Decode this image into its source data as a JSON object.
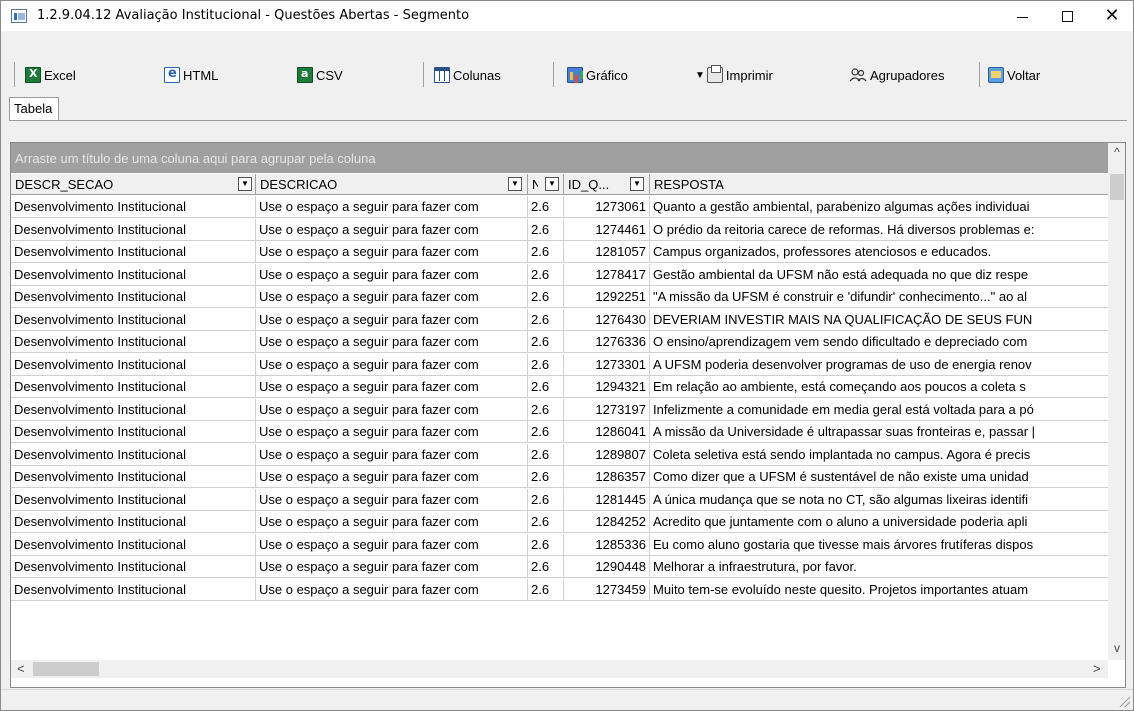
{
  "window": {
    "title": "1.2.9.04.12 Avaliação Institucional - Questões Abertas - Segmento",
    "minimize_glyph": "—",
    "maximize_glyph": "☐",
    "close_glyph": "✕"
  },
  "toolbar": {
    "excel": "Excel",
    "html": "HTML",
    "csv": "CSV",
    "columns": "Colunas",
    "chart": "Gráfico",
    "print": "Imprimir",
    "groupers": "Agrupadores",
    "back": "Voltar",
    "icons": [
      "excel-icon",
      "html-icon",
      "csv-icon",
      "columns-icon",
      "chart-icon",
      "print-icon",
      "groupers-icon",
      "back-icon"
    ]
  },
  "tabs": [
    {
      "label": "Tabela"
    }
  ],
  "grid": {
    "group_panel_hint": "Arraste um título de uma coluna aqui para agrupar pela coluna",
    "columns": [
      "DESCR_SECAO",
      "DESCRICAO",
      "N",
      "ID_Q...",
      "RESPOSTA"
    ],
    "rows": [
      [
        "Desenvolvimento Institucional",
        "Use o espaço a seguir para fazer com",
        "2.6",
        "1273061",
        "Quanto a gestão ambiental, parabenizo algumas ações individuai"
      ],
      [
        "Desenvolvimento Institucional",
        "Use o espaço a seguir para fazer com",
        "2.6",
        "1274461",
        "O prédio da reitoria carece de reformas. Há diversos problemas e:"
      ],
      [
        "Desenvolvimento Institucional",
        "Use o espaço a seguir para fazer com",
        "2.6",
        "1281057",
        "Campus organizados, professores atenciosos e educados."
      ],
      [
        "Desenvolvimento Institucional",
        "Use o espaço a seguir para fazer com",
        "2.6",
        "1278417",
        "Gestão ambiental da UFSM não está adequada no que diz respe"
      ],
      [
        "Desenvolvimento Institucional",
        "Use o espaço a seguir para fazer com",
        "2.6",
        "1292251",
        "\"A missão da UFSM é construir e 'difundir' conhecimento...\" ao al"
      ],
      [
        "Desenvolvimento Institucional",
        "Use o espaço a seguir para fazer com",
        "2.6",
        "1276430",
        "DEVERIAM INVESTIR MAIS NA QUALIFICAÇÃO DE SEUS FUN"
      ],
      [
        "Desenvolvimento Institucional",
        "Use o espaço a seguir para fazer com",
        "2.6",
        "1276336",
        "O ensino/aprendizagem vem sendo dificultado e depreciado com"
      ],
      [
        "Desenvolvimento Institucional",
        "Use o espaço a seguir para fazer com",
        "2.6",
        "1273301",
        "A UFSM poderia desenvolver programas de uso de energia renov"
      ],
      [
        "Desenvolvimento Institucional",
        "Use o espaço a seguir para fazer com",
        "2.6",
        "1294321",
        "Em relação ao ambiente, está começando aos poucos a coleta s"
      ],
      [
        "Desenvolvimento Institucional",
        "Use o espaço a seguir para fazer com",
        "2.6",
        "1273197",
        "Infelizmente a comunidade em media geral está voltada para a pó"
      ],
      [
        "Desenvolvimento Institucional",
        "Use o espaço a seguir para fazer com",
        "2.6",
        "1286041",
        "A missão da Universidade é ultrapassar suas fronteiras e, passar |"
      ],
      [
        "Desenvolvimento Institucional",
        "Use o espaço a seguir para fazer com",
        "2.6",
        "1289807",
        "Coleta seletiva está sendo implantada no campus. Agora é precis"
      ],
      [
        "Desenvolvimento Institucional",
        "Use o espaço a seguir para fazer com",
        "2.6",
        "1286357",
        "Como dizer que a UFSM é sustentável de não existe uma unidad"
      ],
      [
        "Desenvolvimento Institucional",
        "Use o espaço a seguir para fazer com",
        "2.6",
        "1281445",
        "A única mudança que se nota no CT, são algumas lixeiras identifi"
      ],
      [
        "Desenvolvimento Institucional",
        "Use o espaço a seguir para fazer com",
        "2.6",
        "1284252",
        "Acredito que juntamente com o aluno a universidade poderia apli"
      ],
      [
        "Desenvolvimento Institucional",
        "Use o espaço a seguir para fazer com",
        "2.6",
        "1285336",
        "Eu como aluno gostaria que tivesse mais árvores frutíferas dispos"
      ],
      [
        "Desenvolvimento Institucional",
        "Use o espaço a seguir para fazer com",
        "2.6",
        "1290448",
        "Melhorar a infraestrutura, por favor."
      ],
      [
        "Desenvolvimento Institucional",
        "Use o espaço a seguir para fazer com",
        "2.6",
        "1273459",
        "Muito tem-se evoluído neste quesito. Projetos importantes atuam"
      ]
    ]
  },
  "scroll_glyphs": {
    "up": "^",
    "down": "v",
    "left": "<",
    "right": ">"
  }
}
